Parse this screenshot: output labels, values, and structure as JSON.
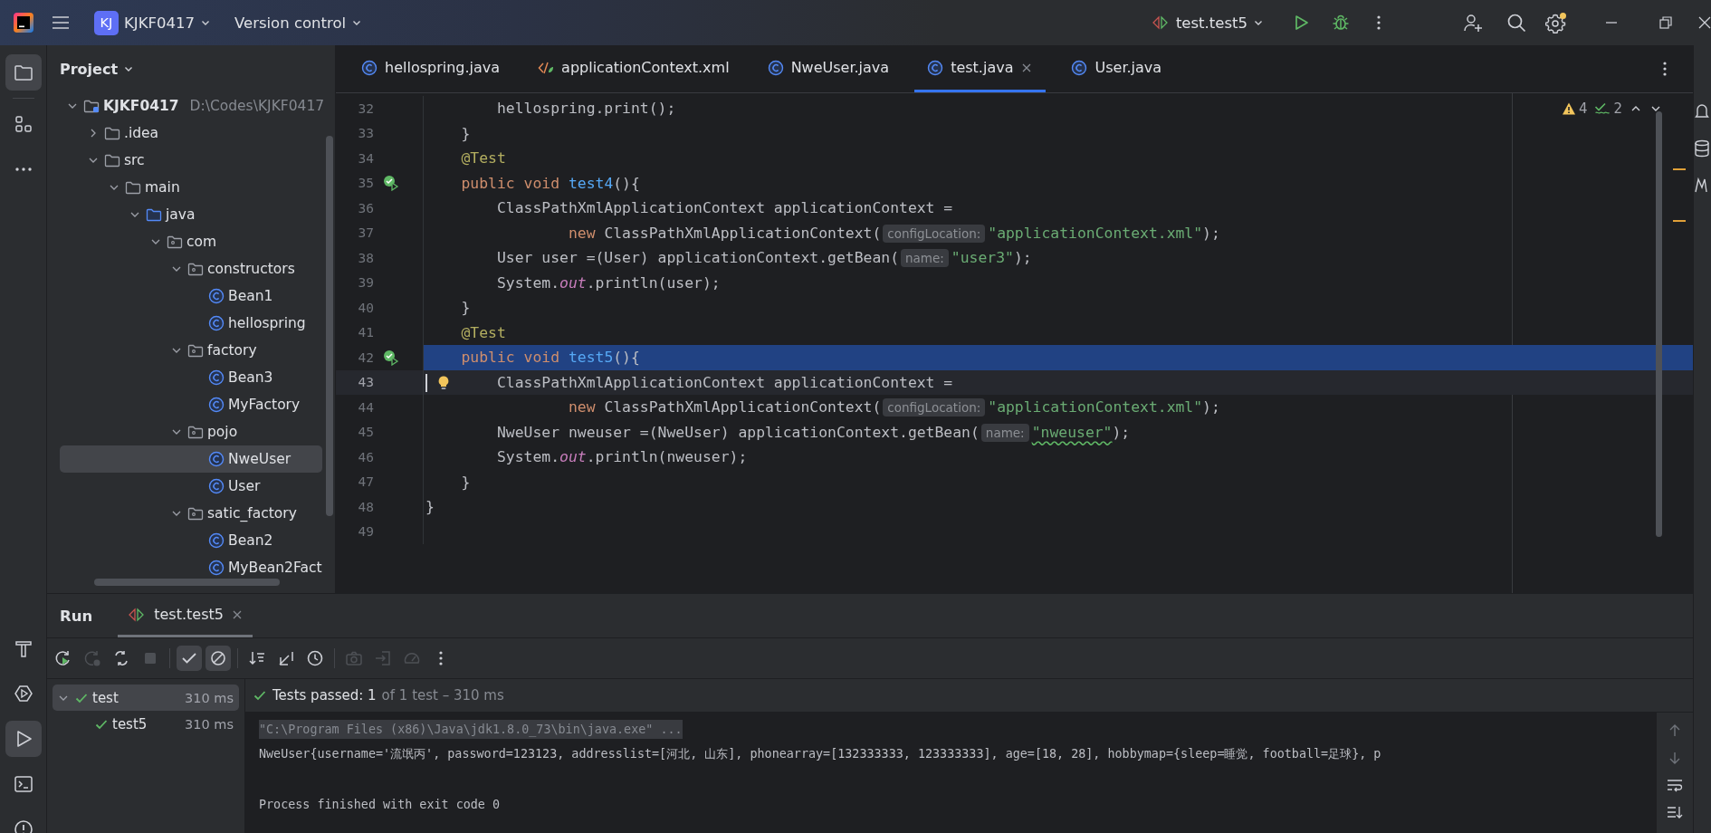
{
  "title_bar": {
    "project_badge": "KJ",
    "project": "KJKF0417",
    "vcs": "Version control",
    "run_config": "test.test5",
    "settings_notice": true
  },
  "left_toolbar": [
    {
      "kind": "project",
      "selected": true
    },
    {
      "kind": "structure",
      "selected": false
    },
    {
      "kind": "more",
      "selected": false
    },
    {
      "kind": "build",
      "selected": false
    },
    {
      "kind": "services",
      "selected": false
    },
    {
      "kind": "run",
      "selected": true
    },
    {
      "kind": "terminal",
      "selected": false
    },
    {
      "kind": "problems",
      "selected": false
    }
  ],
  "project_panel": {
    "title": "Project",
    "tree": [
      {
        "name": "KJKF0417",
        "path": "D:\\Codes\\KJKF0417",
        "kind": "module",
        "expanded": true,
        "selected": false,
        "children": [
          {
            "name": ".idea",
            "kind": "folder",
            "expanded": false,
            "selected": false
          },
          {
            "name": "src",
            "kind": "folder",
            "expanded": true,
            "selected": false,
            "children": [
              {
                "name": "main",
                "kind": "folder",
                "expanded": true,
                "selected": false,
                "children": [
                  {
                    "name": "java",
                    "kind": "source",
                    "expanded": true,
                    "selected": false,
                    "children": [
                      {
                        "name": "com",
                        "kind": "package",
                        "expanded": true,
                        "selected": false,
                        "children": [
                          {
                            "name": "constructors",
                            "kind": "package",
                            "expanded": true,
                            "selected": false,
                            "children": [
                              {
                                "name": "Bean1",
                                "kind": "class",
                                "selected": false
                              },
                              {
                                "name": "hellospring",
                                "kind": "class",
                                "selected": false
                              }
                            ]
                          },
                          {
                            "name": "factory",
                            "kind": "package",
                            "expanded": true,
                            "selected": false,
                            "children": [
                              {
                                "name": "Bean3",
                                "kind": "class",
                                "selected": false
                              },
                              {
                                "name": "MyFactory",
                                "kind": "class",
                                "selected": false
                              }
                            ]
                          },
                          {
                            "name": "pojo",
                            "kind": "package",
                            "expanded": true,
                            "selected": false,
                            "children": [
                              {
                                "name": "NweUser",
                                "kind": "class",
                                "selected": true
                              },
                              {
                                "name": "User",
                                "kind": "class",
                                "selected": false
                              }
                            ]
                          },
                          {
                            "name": "satic_factory",
                            "kind": "package",
                            "expanded": true,
                            "selected": false,
                            "children": [
                              {
                                "name": "Bean2",
                                "kind": "class",
                                "selected": false
                              },
                              {
                                "name": "MyBean2Fact",
                                "kind": "class",
                                "selected": false
                              }
                            ]
                          }
                        ]
                      }
                    ]
                  }
                ]
              }
            ]
          }
        ]
      }
    ]
  },
  "editor": {
    "tabs": [
      {
        "label": "hellospring.java",
        "kind": "class",
        "selected": false
      },
      {
        "label": "applicationContext.xml",
        "kind": "xml",
        "selected": false
      },
      {
        "label": "NweUser.java",
        "kind": "class",
        "selected": false
      },
      {
        "label": "test.java",
        "kind": "class",
        "selected": true
      },
      {
        "label": "User.java",
        "kind": "class",
        "selected": false
      }
    ],
    "inspections": {
      "warnings": "4",
      "checks": "2"
    },
    "lines": [
      {
        "number": "32",
        "selected": false,
        "current": false,
        "run_marker": false,
        "bulb": false,
        "segments": [
          {
            "kind": "plain",
            "text": "        hellospring.print();"
          }
        ]
      },
      {
        "number": "33",
        "selected": false,
        "current": false,
        "run_marker": false,
        "bulb": false,
        "segments": [
          {
            "kind": "plain",
            "text": "    }"
          }
        ]
      },
      {
        "number": "34",
        "selected": false,
        "current": false,
        "run_marker": false,
        "bulb": false,
        "segments": [
          {
            "kind": "annotation",
            "text": "    @Test"
          }
        ]
      },
      {
        "number": "35",
        "selected": false,
        "current": false,
        "run_marker": true,
        "bulb": false,
        "segments": [
          {
            "kind": "keyword",
            "text": "    public void "
          },
          {
            "kind": "method",
            "text": "test4"
          },
          {
            "kind": "plain",
            "text": "(){"
          }
        ]
      },
      {
        "number": "36",
        "selected": false,
        "current": false,
        "run_marker": false,
        "bulb": false,
        "segments": [
          {
            "kind": "plain",
            "text": "        ClassPathXmlApplicationContext applicationContext ="
          }
        ]
      },
      {
        "number": "37",
        "selected": false,
        "current": false,
        "run_marker": false,
        "bulb": false,
        "segments": [
          {
            "kind": "keyword",
            "text": "                new "
          },
          {
            "kind": "plain",
            "text": "ClassPathXmlApplicationContext("
          },
          {
            "kind": "hint",
            "text": "configLocation:"
          },
          {
            "kind": "string",
            "text": "\"applicationContext.xml\""
          },
          {
            "kind": "plain",
            "text": ");"
          }
        ]
      },
      {
        "number": "38",
        "selected": false,
        "current": false,
        "run_marker": false,
        "bulb": false,
        "segments": [
          {
            "kind": "plain",
            "text": "        User user =(User) applicationContext.getBean("
          },
          {
            "kind": "hint",
            "text": "name:"
          },
          {
            "kind": "string",
            "text": "\"user3\""
          },
          {
            "kind": "plain",
            "text": ");"
          }
        ]
      },
      {
        "number": "39",
        "selected": false,
        "current": false,
        "run_marker": false,
        "bulb": false,
        "segments": [
          {
            "kind": "plain",
            "text": "        System."
          },
          {
            "kind": "field",
            "text": "out"
          },
          {
            "kind": "plain",
            "text": ".println(user);"
          }
        ]
      },
      {
        "number": "40",
        "selected": false,
        "current": false,
        "run_marker": false,
        "bulb": false,
        "segments": [
          {
            "kind": "plain",
            "text": "    }"
          }
        ]
      },
      {
        "number": "41",
        "selected": false,
        "current": false,
        "run_marker": false,
        "bulb": false,
        "segments": [
          {
            "kind": "annotation",
            "text": "    @Test"
          }
        ]
      },
      {
        "number": "42",
        "selected": true,
        "current": false,
        "run_marker": true,
        "bulb": false,
        "segments": [
          {
            "kind": "keyword",
            "text": "    public void "
          },
          {
            "kind": "method",
            "text": "test5"
          },
          {
            "kind": "plain",
            "text": "(){"
          }
        ]
      },
      {
        "number": "43",
        "selected": false,
        "current": true,
        "run_marker": false,
        "bulb": true,
        "segments": [
          {
            "kind": "plain",
            "text": "        ClassPathXmlApplicationContext applicationContext ="
          }
        ]
      },
      {
        "number": "44",
        "selected": false,
        "current": false,
        "run_marker": false,
        "bulb": false,
        "segments": [
          {
            "kind": "keyword",
            "text": "                new "
          },
          {
            "kind": "plain",
            "text": "ClassPathXmlApplicationContext("
          },
          {
            "kind": "hint",
            "text": "configLocation:"
          },
          {
            "kind": "string",
            "text": "\"applicationContext.xml\""
          },
          {
            "kind": "plain",
            "text": ");"
          }
        ]
      },
      {
        "number": "45",
        "selected": false,
        "current": false,
        "run_marker": false,
        "bulb": false,
        "segments": [
          {
            "kind": "plain",
            "text": "        NweUser nweuser =(NweUser) applicationContext.getBean("
          },
          {
            "kind": "hint",
            "text": "name:"
          },
          {
            "kind": "typo_string",
            "text": "\"nweuser\""
          },
          {
            "kind": "plain",
            "text": ");"
          }
        ]
      },
      {
        "number": "46",
        "selected": false,
        "current": false,
        "run_marker": false,
        "bulb": false,
        "segments": [
          {
            "kind": "plain",
            "text": "        System."
          },
          {
            "kind": "field",
            "text": "out"
          },
          {
            "kind": "plain",
            "text": ".println(nweuser);"
          }
        ]
      },
      {
        "number": "47",
        "selected": false,
        "current": false,
        "run_marker": false,
        "bulb": false,
        "segments": [
          {
            "kind": "plain",
            "text": "    }"
          }
        ]
      },
      {
        "number": "48",
        "selected": false,
        "current": false,
        "run_marker": false,
        "bulb": false,
        "segments": [
          {
            "kind": "plain",
            "text": "}"
          }
        ]
      },
      {
        "number": "49",
        "selected": false,
        "current": false,
        "run_marker": false,
        "bulb": false
      }
    ]
  },
  "run_panel": {
    "title": "Run",
    "tab": "test.test5",
    "toolbar": [
      {
        "items": [
          {
            "kind": "rerun",
            "on": false,
            "disabled": false
          },
          {
            "kind": "rerun-failed",
            "on": false,
            "disabled": true
          },
          {
            "kind": "toggle-auto",
            "on": false,
            "disabled": false
          },
          {
            "kind": "stop",
            "on": false,
            "disabled": true
          }
        ]
      },
      {
        "items": [
          {
            "kind": "show-passed",
            "on": true,
            "disabled": false
          },
          {
            "kind": "show-ignored",
            "on": true,
            "disabled": false
          }
        ]
      },
      {
        "items": [
          {
            "kind": "sort",
            "on": false,
            "disabled": false
          },
          {
            "kind": "collapse",
            "on": false,
            "disabled": false
          },
          {
            "kind": "history",
            "on": false,
            "disabled": false
          }
        ]
      },
      {
        "items": [
          {
            "kind": "camera",
            "on": false,
            "disabled": true
          },
          {
            "kind": "import",
            "on": false,
            "disabled": true
          },
          {
            "kind": "gauge",
            "on": false,
            "disabled": true
          },
          {
            "kind": "more",
            "on": false,
            "disabled": false
          }
        ]
      }
    ],
    "tests": [
      {
        "name": "test",
        "time": "310 ms",
        "passed": true,
        "selected": true,
        "expanded": true,
        "children": [
          {
            "name": "test5",
            "time": "310 ms",
            "passed": true,
            "selected": false
          }
        ]
      }
    ],
    "status": {
      "passed": true,
      "label": "Tests passed: 1",
      "detail": "of 1 test – 310 ms"
    },
    "console": [
      {
        "kind": "command",
        "text": "\"C:\\Program Files (x86)\\Java\\jdk1.8.0_73\\bin\\java.exe\" ..."
      },
      {
        "kind": "output",
        "text": "NweUser{username='流氓丙', password=123123, addresslist=[河北, 山东], phonearray=[132333333, 123333333], age=[18, 28], hobbymap={sleep=睡觉, football=足球}, p"
      },
      {
        "kind": "blank"
      },
      {
        "kind": "output",
        "text": "Process finished with exit code 0"
      }
    ]
  }
}
